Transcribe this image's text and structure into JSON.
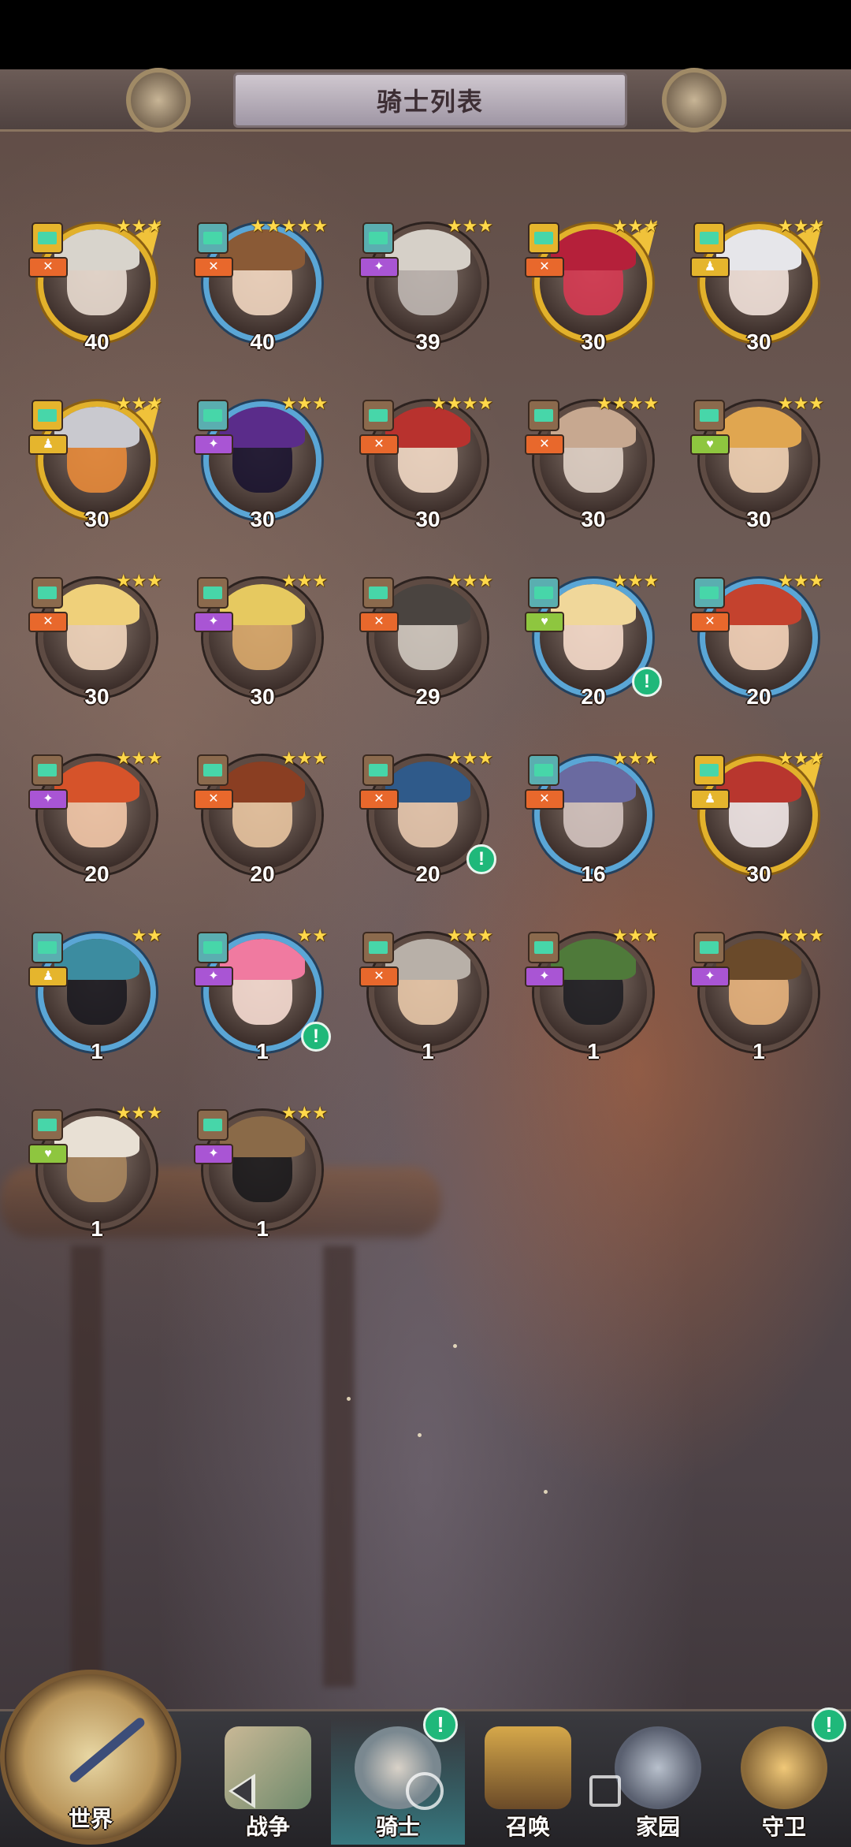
{
  "header": {
    "title": "骑士列表"
  },
  "knights": [
    {
      "level": "40",
      "stars": "★★★",
      "frame": "gold",
      "cls": "gold",
      "role": "orange",
      "skin": "#e9dcd0",
      "hairc": "#d8d4cc",
      "alert": false,
      "wing": true
    },
    {
      "level": "40",
      "stars": "★★★★★",
      "frame": "blue",
      "cls": "teal",
      "role": "orange",
      "skin": "#f1d6c0",
      "hairc": "#8a5a36",
      "alert": false,
      "wing": false
    },
    {
      "level": "39",
      "stars": "★★★",
      "frame": "brown",
      "cls": "teal",
      "role": "purple",
      "skin": "#bfb7b2",
      "hairc": "#d6d0c8",
      "alert": false,
      "wing": false
    },
    {
      "level": "30",
      "stars": "★★★",
      "frame": "gold",
      "cls": "gold",
      "role": "orange",
      "skin": "#d63a52",
      "hairc": "#b5203a",
      "alert": false,
      "wing": true
    },
    {
      "level": "30",
      "stars": "★★★",
      "frame": "gold",
      "cls": "gold",
      "role": "gold",
      "skin": "#f2e2da",
      "hairc": "#e6e6ea",
      "alert": false,
      "wing": true
    },
    {
      "level": "30",
      "stars": "★★★",
      "frame": "gold",
      "cls": "gold",
      "role": "gold",
      "skin": "#e78a3a",
      "hairc": "#c9c9cf",
      "alert": false,
      "wing": true
    },
    {
      "level": "30",
      "stars": "★★★",
      "frame": "blue",
      "cls": "teal",
      "role": "purple",
      "skin": "#1b1430",
      "hairc": "#5a2c8a",
      "alert": false,
      "wing": false
    },
    {
      "level": "30",
      "stars": "★★★★",
      "frame": "brown",
      "cls": "brown",
      "role": "orange",
      "skin": "#f1d8c4",
      "hairc": "#b8322e",
      "alert": false,
      "wing": false
    },
    {
      "level": "30",
      "stars": "★★★★",
      "frame": "brown",
      "cls": "brown",
      "role": "orange",
      "skin": "#e0d2c6",
      "hairc": "#c7a890",
      "alert": false,
      "wing": false
    },
    {
      "level": "30",
      "stars": "★★★",
      "frame": "brown",
      "cls": "brown",
      "role": "green",
      "skin": "#f1d1b4",
      "hairc": "#e0a650",
      "alert": false,
      "wing": false
    },
    {
      "level": "30",
      "stars": "★★★",
      "frame": "brown",
      "cls": "brown",
      "role": "orange",
      "skin": "#f2d6bc",
      "hairc": "#efd07a",
      "alert": false,
      "wing": false
    },
    {
      "level": "30",
      "stars": "★★★",
      "frame": "brown",
      "cls": "brown",
      "role": "purple",
      "skin": "#d9a86a",
      "hairc": "#e6c960",
      "alert": false,
      "wing": false
    },
    {
      "level": "29",
      "stars": "★★★",
      "frame": "brown",
      "cls": "brown",
      "role": "orange",
      "skin": "#cfc8bf",
      "hairc": "#4a4440",
      "alert": false,
      "wing": false
    },
    {
      "level": "20",
      "stars": "★★★",
      "frame": "blue",
      "cls": "teal",
      "role": "green",
      "skin": "#f6dccb",
      "hairc": "#f0d79a",
      "alert": true,
      "wing": false
    },
    {
      "level": "20",
      "stars": "★★★",
      "frame": "blue",
      "cls": "teal",
      "role": "orange",
      "skin": "#f3d1b8",
      "hairc": "#c4422e",
      "alert": false,
      "wing": false
    },
    {
      "level": "20",
      "stars": "★★★",
      "frame": "brown",
      "cls": "brown",
      "role": "purple",
      "skin": "#f3c8a8",
      "hairc": "#d6532a",
      "alert": false,
      "wing": false
    },
    {
      "level": "20",
      "stars": "★★★",
      "frame": "brown",
      "cls": "brown",
      "role": "orange",
      "skin": "#e8c4a0",
      "hairc": "#8a3e22",
      "alert": false,
      "wing": false
    },
    {
      "level": "20",
      "stars": "★★★",
      "frame": "brown",
      "cls": "brown",
      "role": "orange",
      "skin": "#e7c8ae",
      "hairc": "#2f5a8a",
      "alert": true,
      "wing": false
    },
    {
      "level": "16",
      "stars": "★★★",
      "frame": "blue",
      "cls": "teal",
      "role": "orange",
      "skin": "#d4c4c0",
      "hairc": "#6a6aa0",
      "alert": false,
      "wing": false
    },
    {
      "level": "30",
      "stars": "★★★",
      "frame": "gold",
      "cls": "gold",
      "role": "gold",
      "skin": "#f0e6e6",
      "hairc": "#b8362e",
      "alert": false,
      "wing": true
    },
    {
      "level": "1",
      "stars": "★★",
      "frame": "blue",
      "cls": "teal",
      "role": "gold",
      "skin": "#1b1a20",
      "hairc": "#3c8ca0",
      "alert": false,
      "wing": false
    },
    {
      "level": "1",
      "stars": "★★",
      "frame": "blue",
      "cls": "teal",
      "role": "purple",
      "skin": "#f6dcd2",
      "hairc": "#f07aa0",
      "alert": true,
      "wing": false
    },
    {
      "level": "1",
      "stars": "★★★",
      "frame": "brown",
      "cls": "brown",
      "role": "orange",
      "skin": "#e8c8a8",
      "hairc": "#b8b0a8",
      "alert": false,
      "wing": false
    },
    {
      "level": "1",
      "stars": "★★★",
      "frame": "brown",
      "cls": "brown",
      "role": "purple",
      "skin": "#1f1f24",
      "hairc": "#4f7a3a",
      "alert": false,
      "wing": false
    },
    {
      "level": "1",
      "stars": "★★★",
      "frame": "brown",
      "cls": "brown",
      "role": "purple",
      "skin": "#e7b27c",
      "hairc": "#6a4a2a",
      "alert": false,
      "wing": false
    },
    {
      "level": "1",
      "stars": "★★★",
      "frame": "brown",
      "cls": "brown",
      "role": "green",
      "skin": "#a8865e",
      "hairc": "#e8e0d4",
      "alert": false,
      "wing": false
    },
    {
      "level": "1",
      "stars": "★★★",
      "frame": "brown",
      "cls": "brown",
      "role": "purple",
      "skin": "#1b1a1c",
      "hairc": "#8a6a48",
      "alert": false,
      "wing": false
    }
  ],
  "nav": {
    "items": [
      {
        "label": "世界",
        "id": "world"
      },
      {
        "label": "战争",
        "id": "war"
      },
      {
        "label": "骑士",
        "id": "knights"
      },
      {
        "label": "召唤",
        "id": "summon"
      },
      {
        "label": "家园",
        "id": "home"
      },
      {
        "label": "守卫",
        "id": "guard"
      }
    ],
    "alert_symbol": "!"
  },
  "colors": {
    "alert": "#1fb87a",
    "star": "#ffd84a",
    "frame_gold": "#e2b12b",
    "frame_blue": "#5aa6d6"
  }
}
